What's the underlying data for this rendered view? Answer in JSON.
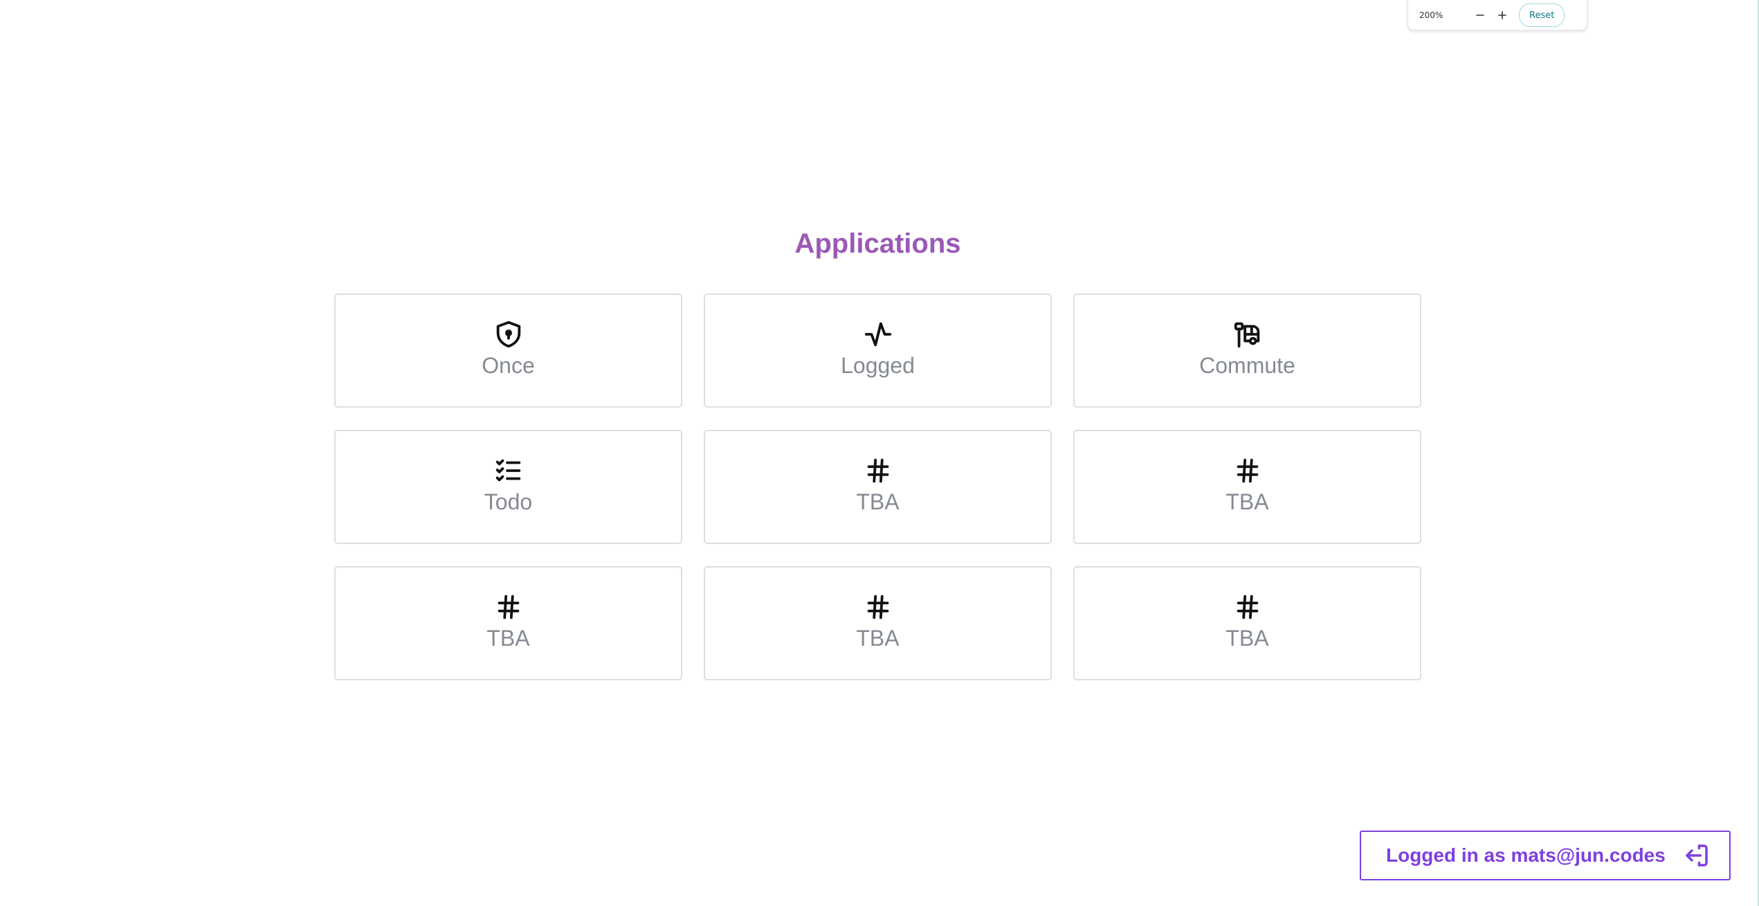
{
  "zoom": {
    "level": "200%",
    "decrease_icon": "minus-icon",
    "increase_icon": "plus-icon",
    "reset_label": "Reset"
  },
  "page": {
    "title": "Applications"
  },
  "apps": [
    {
      "label": "Once",
      "icon": "shield-lock-icon"
    },
    {
      "label": "Logged",
      "icon": "activity-icon"
    },
    {
      "label": "Commute",
      "icon": "bus-stop-icon"
    },
    {
      "label": "Todo",
      "icon": "list-check-icon"
    },
    {
      "label": "TBA",
      "icon": "hash-icon"
    },
    {
      "label": "TBA",
      "icon": "hash-icon"
    },
    {
      "label": "TBA",
      "icon": "hash-icon"
    },
    {
      "label": "TBA",
      "icon": "hash-icon"
    },
    {
      "label": "TBA",
      "icon": "hash-icon"
    }
  ],
  "auth": {
    "label": "Logged in as mats@jun.codes",
    "icon": "logout-icon"
  },
  "colors": {
    "title": "#9b59b6",
    "accent": "#7e3fe0",
    "card_border": "#dedede",
    "card_label": "#858a92"
  }
}
